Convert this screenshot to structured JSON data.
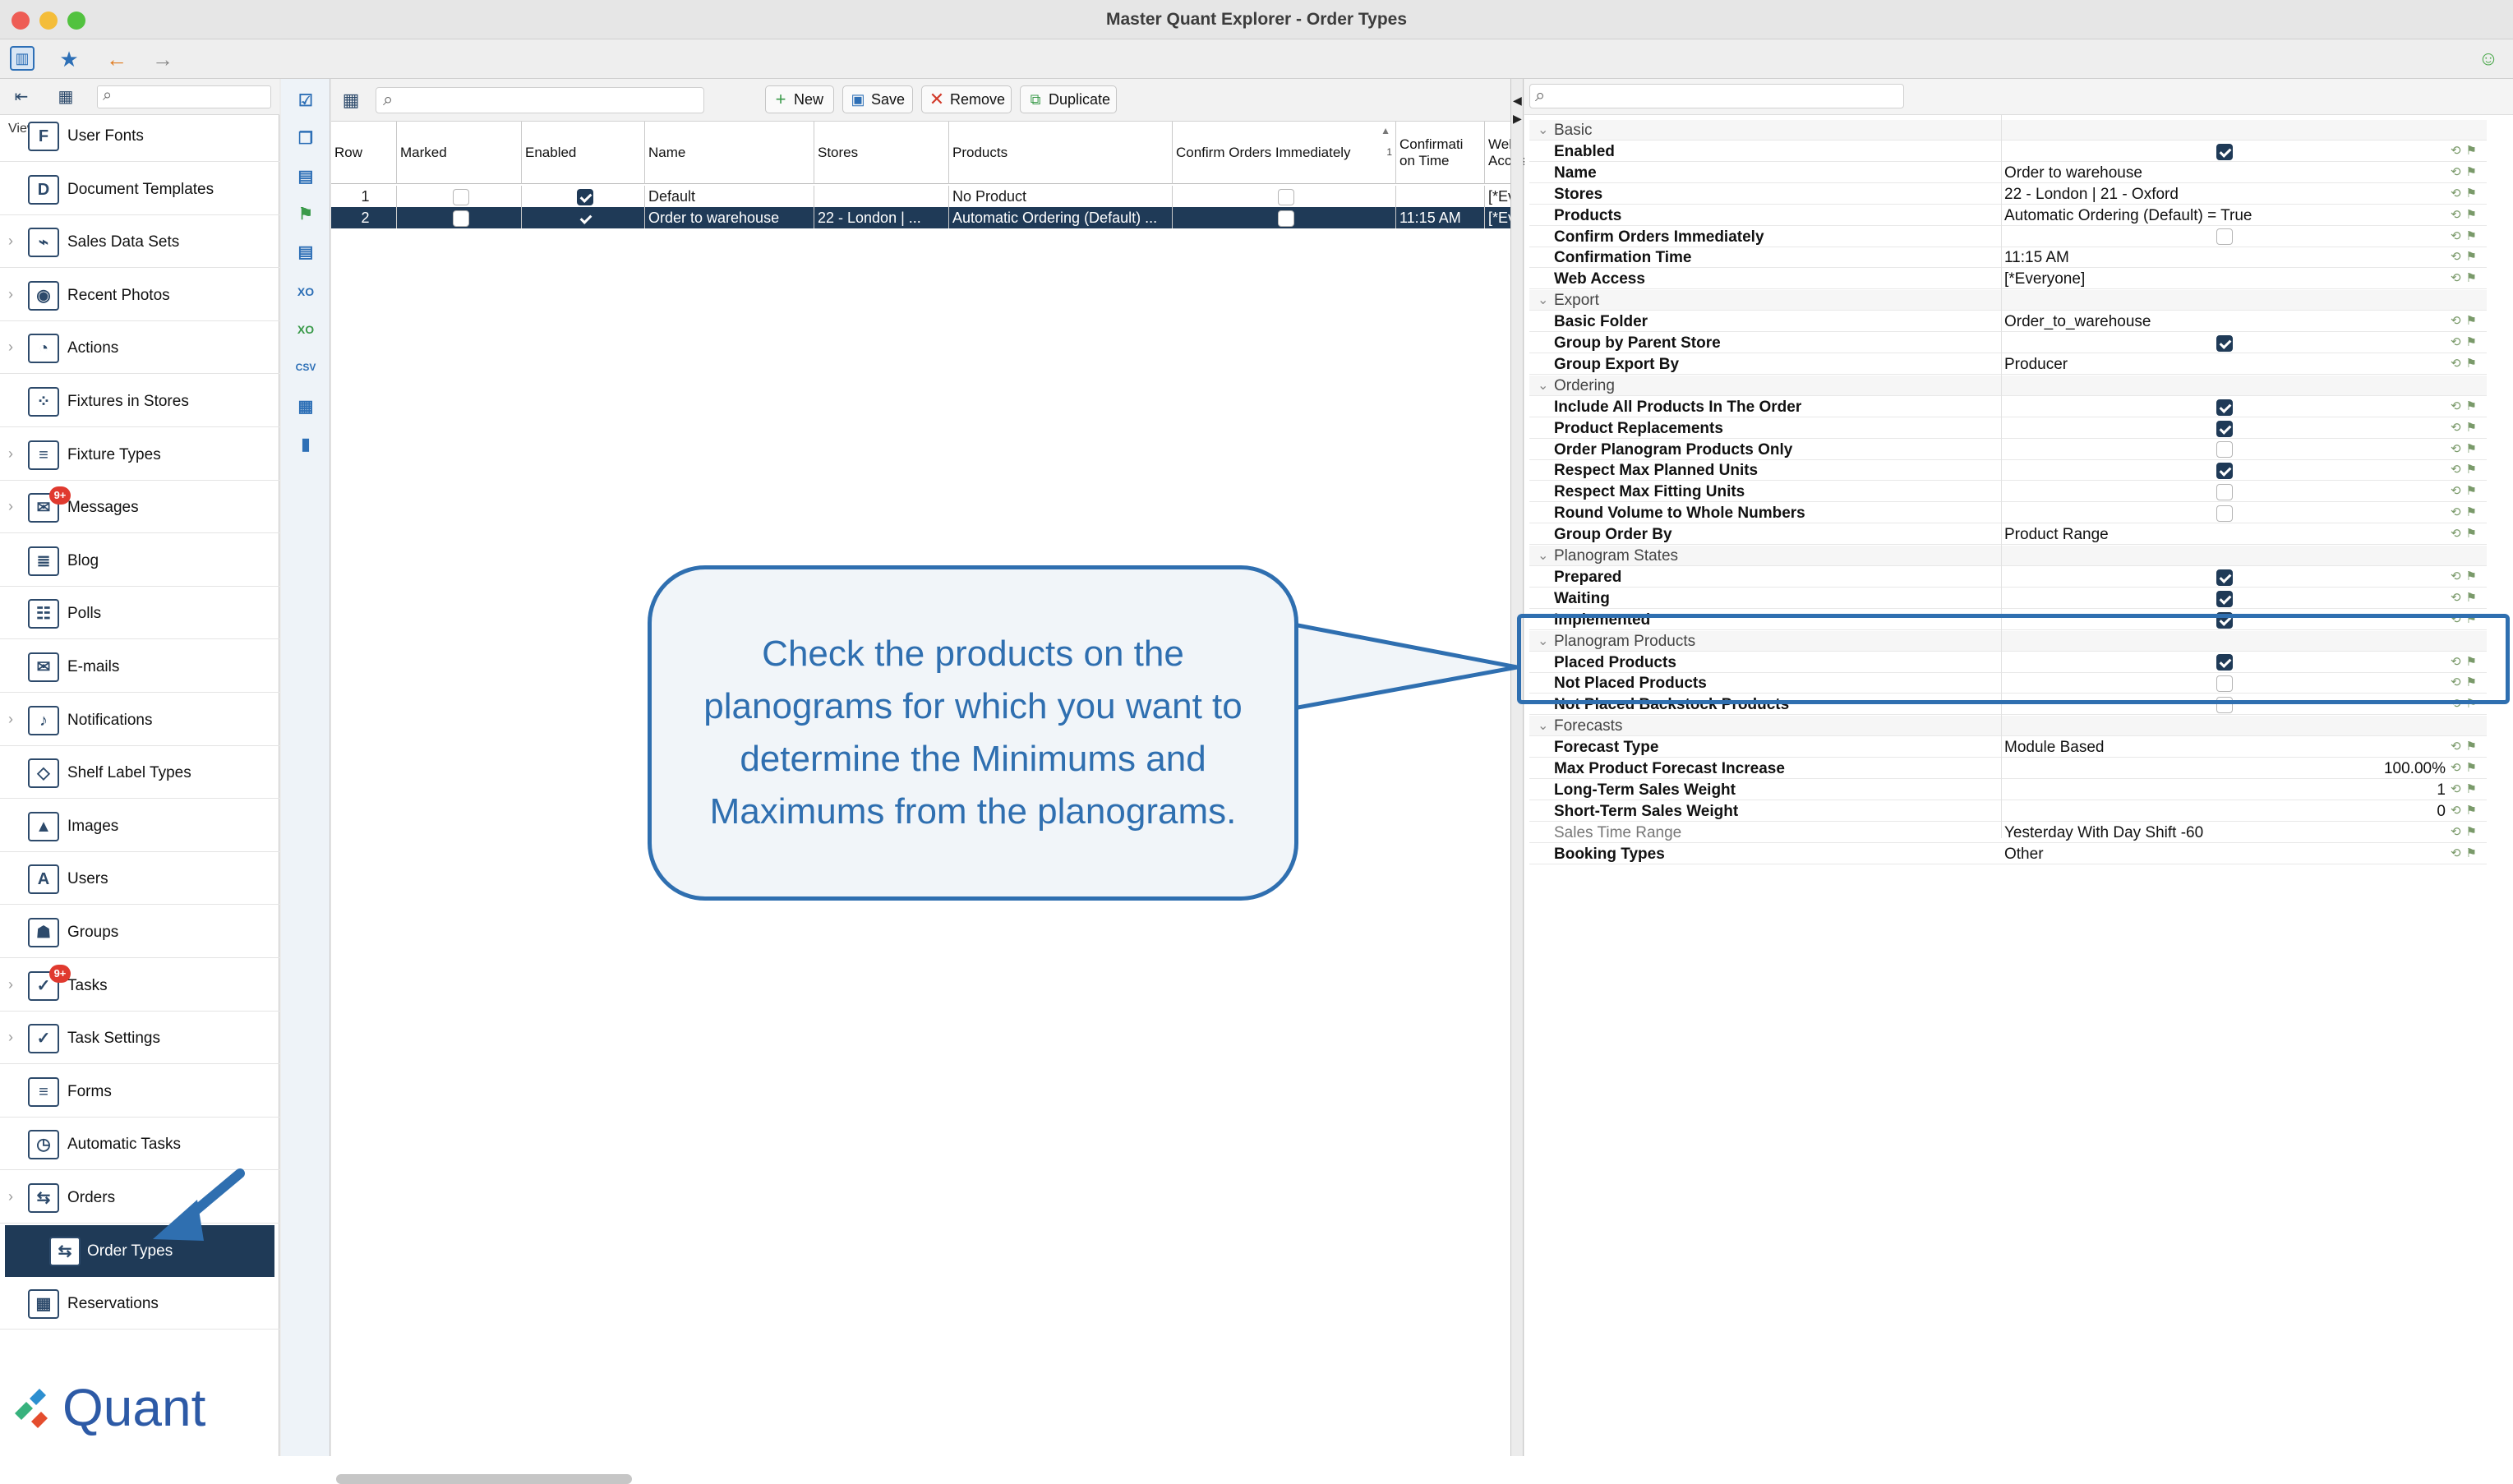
{
  "window": {
    "title": "Master Quant Explorer - Order Types"
  },
  "nav": {
    "view_label": "View",
    "items": [
      {
        "label": "User Fonts",
        "icon": "fonts-icon",
        "chevron": false
      },
      {
        "label": "Document Templates",
        "icon": "templates-icon",
        "chevron": false
      },
      {
        "label": "Sales Data Sets",
        "icon": "sales-data-icon",
        "chevron": true
      },
      {
        "label": "Recent Photos",
        "icon": "camera-icon",
        "chevron": true
      },
      {
        "label": "Actions",
        "icon": "actions-icon",
        "chevron": true
      },
      {
        "label": "Fixtures in Stores",
        "icon": "fixtures-icon",
        "chevron": false
      },
      {
        "label": "Fixture Types",
        "icon": "fixture-types-icon",
        "chevron": true
      },
      {
        "label": "Messages",
        "icon": "messages-icon",
        "chevron": true,
        "badge": "9+"
      },
      {
        "label": "Blog",
        "icon": "blog-icon",
        "chevron": false
      },
      {
        "label": "Polls",
        "icon": "polls-icon",
        "chevron": false
      },
      {
        "label": "E-mails",
        "icon": "mail-icon",
        "chevron": false
      },
      {
        "label": "Notifications",
        "icon": "bell-icon",
        "chevron": true
      },
      {
        "label": "Shelf Label Types",
        "icon": "label-icon",
        "chevron": false
      },
      {
        "label": "Images",
        "icon": "image-icon",
        "chevron": false
      },
      {
        "label": "Users",
        "icon": "user-icon",
        "chevron": false
      },
      {
        "label": "Groups",
        "icon": "group-icon",
        "chevron": false
      },
      {
        "label": "Tasks",
        "icon": "tasks-icon",
        "chevron": true,
        "badge": "9+"
      },
      {
        "label": "Task Settings",
        "icon": "task-settings-icon",
        "chevron": true
      },
      {
        "label": "Forms",
        "icon": "forms-icon",
        "chevron": false
      },
      {
        "label": "Automatic Tasks",
        "icon": "auto-tasks-icon",
        "chevron": false
      },
      {
        "label": "Orders",
        "icon": "orders-icon",
        "chevron": true
      },
      {
        "label": "Order Types",
        "icon": "order-types-icon",
        "chevron": false,
        "selected": true
      },
      {
        "label": "Reservations",
        "icon": "calendar-icon",
        "chevron": false
      }
    ],
    "logo_text": "Quant"
  },
  "toolbar": {
    "new_label": "New",
    "save_label": "Save",
    "remove_label": "Remove",
    "duplicate_label": "Duplicate"
  },
  "grid": {
    "columns": [
      "Row",
      "Marked",
      "Enabled",
      "Name",
      "Stores",
      "Products",
      "Confirm Orders Immediately",
      "Confirmati on Time",
      "Web Access"
    ],
    "sort_indicator": "1",
    "rows": [
      {
        "row": "1",
        "marked": false,
        "enabled": true,
        "name": "Default",
        "stores": "",
        "products": "No Product",
        "confirm": false,
        "time": "",
        "web": "[*Every."
      },
      {
        "row": "2",
        "marked": false,
        "enabled": true,
        "name": "Order to warehouse",
        "stores": "22 - London | ...",
        "products": "Automatic Ordering (Default) ...",
        "confirm": false,
        "time": "11:15 AM",
        "web": "[*Every."
      }
    ]
  },
  "props": {
    "rows": [
      {
        "type": "section",
        "label": "Basic"
      },
      {
        "label": "Enabled",
        "check": true
      },
      {
        "label": "Name",
        "value": "Order to warehouse"
      },
      {
        "label": "Stores",
        "value": "22 - London | 21 - Oxford"
      },
      {
        "label": "Products",
        "value": "Automatic Ordering (Default) = True"
      },
      {
        "label": "Confirm Orders Immediately",
        "check": false
      },
      {
        "label": "Confirmation Time",
        "value": "11:15 AM"
      },
      {
        "label": "Web Access",
        "value": "[*Everyone]"
      },
      {
        "type": "section",
        "label": "Export"
      },
      {
        "label": "Basic Folder",
        "value": "Order_to_warehouse"
      },
      {
        "label": "Group by Parent Store",
        "check": true
      },
      {
        "label": "Group Export By",
        "value": "Producer"
      },
      {
        "type": "section",
        "label": "Ordering"
      },
      {
        "label": "Include All Products In The Order",
        "check": true
      },
      {
        "label": "Product Replacements",
        "check": true
      },
      {
        "label": "Order Planogram Products Only",
        "check": false
      },
      {
        "label": "Respect Max Planned Units",
        "check": true
      },
      {
        "label": "Respect Max Fitting Units",
        "check": false
      },
      {
        "label": "Round Volume to Whole Numbers",
        "check": false
      },
      {
        "label": "Group Order By",
        "value": "Product Range"
      },
      {
        "type": "section",
        "label": "Planogram States"
      },
      {
        "label": "Prepared",
        "check": true
      },
      {
        "label": "Waiting",
        "check": true
      },
      {
        "label": "Implemented",
        "check": true
      },
      {
        "type": "section",
        "label": "Planogram Products"
      },
      {
        "label": "Placed Products",
        "check": true
      },
      {
        "label": "Not Placed Products",
        "check": false
      },
      {
        "label": "Not Placed Backstock Products",
        "check": false
      },
      {
        "type": "section",
        "label": "Forecasts"
      },
      {
        "label": "Forecast Type",
        "value": "Module Based"
      },
      {
        "label": "Max Product Forecast Increase",
        "number": "100.00%"
      },
      {
        "label": "Long-Term Sales Weight",
        "number": "1"
      },
      {
        "label": "Short-Term Sales Weight",
        "number": "0"
      },
      {
        "label": "Sales Time Range",
        "value": "Yesterday With Day Shift -60",
        "dim": true
      },
      {
        "label": "Booking Types",
        "value": "Other"
      }
    ]
  },
  "callout": {
    "text": "Check the products on the planograms for which you want to determine the Minimums and Maximums from the planograms."
  },
  "colors": {
    "accent": "#2f6fb0",
    "selected": "#1f3a57",
    "badge": "#e03a2f"
  }
}
